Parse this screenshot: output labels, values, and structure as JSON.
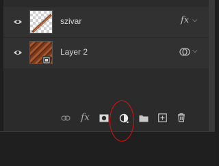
{
  "layers": [
    {
      "name": "szivar",
      "effects": "fx",
      "thumb": "transparent-with-wood-stick"
    },
    {
      "name": "Layer 2",
      "thumb": "wood-planks"
    }
  ],
  "toolbar": {
    "icons": [
      "link-icon",
      "fx-icon",
      "mask-icon",
      "adjustment-layer-icon",
      "folder-icon",
      "new-layer-icon",
      "trash-icon"
    ],
    "fx_label": "fx"
  },
  "colors": {
    "panel_bg": "#2b2b2b",
    "row_bg": "#313131",
    "icon": "#a8a8a8",
    "annotation": "#e01010"
  }
}
